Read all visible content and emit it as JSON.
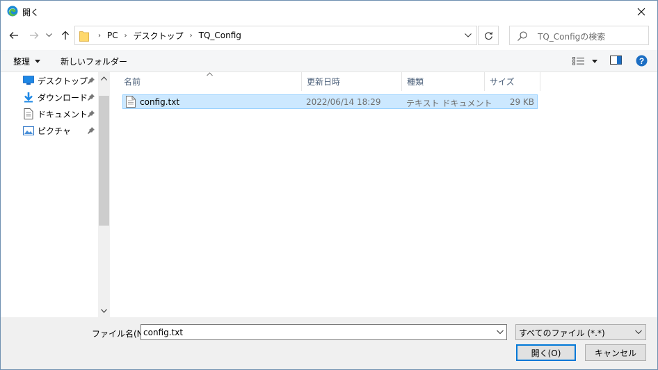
{
  "window": {
    "title": "開く",
    "colors": {
      "accent": "#0078d7",
      "selection_bg": "#cce8ff",
      "selection_border": "#99d1ff",
      "help_blue": "#1c6ec3"
    }
  },
  "address": {
    "crumbs": [
      "PC",
      "デスクトップ",
      "TQ_Config"
    ],
    "separator": "›"
  },
  "search": {
    "placeholder": "TQ_Configの検索"
  },
  "toolbar": {
    "organize_label": "整理",
    "new_folder_label": "新しいフォルダー"
  },
  "nav": {
    "items": [
      {
        "label": "デスクトップ",
        "icon": "desktop-icon"
      },
      {
        "label": "ダウンロード",
        "icon": "download-icon"
      },
      {
        "label": "ドキュメント",
        "icon": "document-icon"
      },
      {
        "label": "ピクチャ",
        "icon": "pictures-icon"
      }
    ]
  },
  "columns": [
    "名前",
    "更新日時",
    "種類",
    "サイズ"
  ],
  "files": [
    {
      "name": "config.txt",
      "modified": "2022/06/14 18:29",
      "type": "テキスト ドキュメント",
      "size": "29 KB",
      "selected": true
    }
  ],
  "bottom": {
    "filename_label": "ファイル名(N):",
    "filename_value": "config.txt",
    "filetype_value": "すべてのファイル (*.*)",
    "open_label": "開く(O)",
    "cancel_label": "キャンセル"
  }
}
